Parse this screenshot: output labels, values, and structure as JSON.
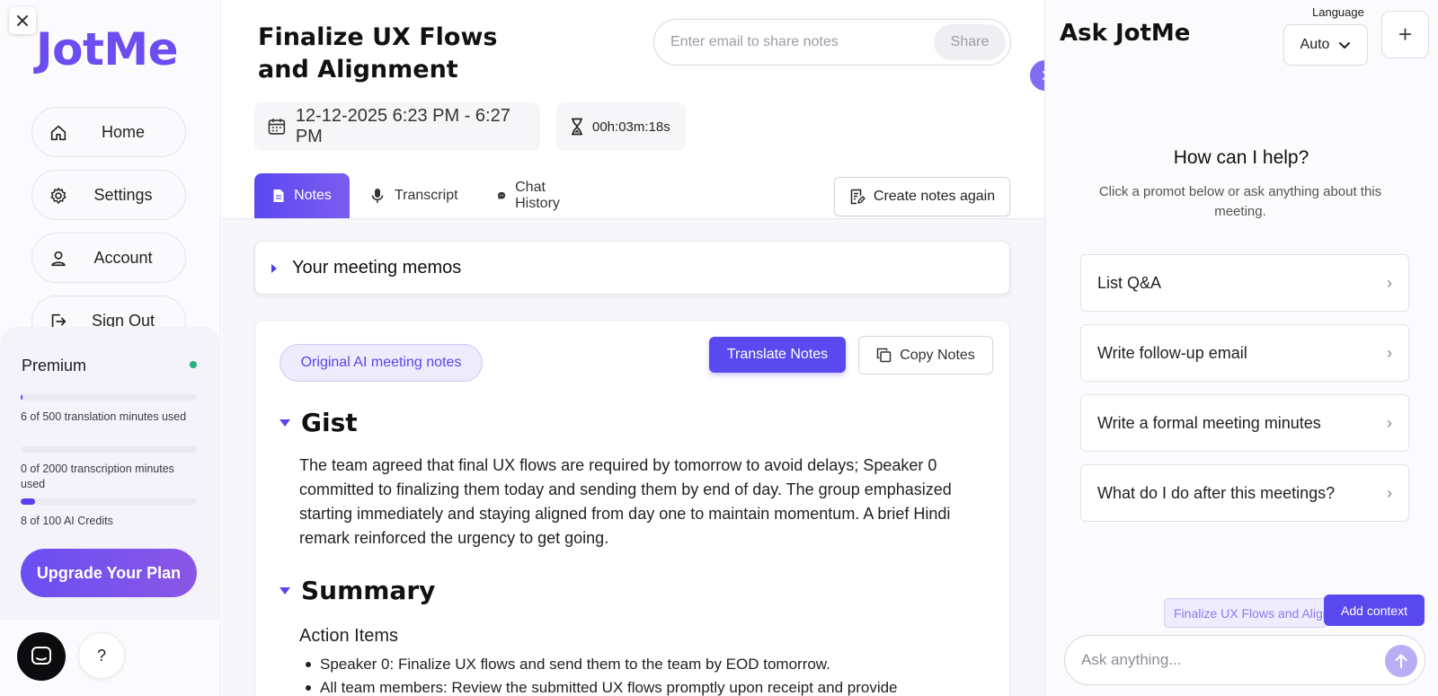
{
  "app": {
    "logo": "JotMe"
  },
  "sidebar": {
    "nav": [
      {
        "label": "Home",
        "icon": "home-icon"
      },
      {
        "label": "Settings",
        "icon": "gear-icon"
      },
      {
        "label": "Account",
        "icon": "user-icon"
      },
      {
        "label": "Sign Out",
        "icon": "sign-out-icon"
      }
    ],
    "plan": {
      "name": "Premium",
      "status_color": "#22b37a",
      "usage": [
        {
          "text": "6 of 500 translation minutes used",
          "used": 6,
          "total": 500
        },
        {
          "text": "0 of 2000 transcription minutes used",
          "used": 0,
          "total": 2000
        },
        {
          "text": "8 of 100 AI Credits",
          "used": 8,
          "total": 100
        }
      ],
      "upgrade_label": "Upgrade Your Plan"
    },
    "help_label": "?"
  },
  "meeting": {
    "title": "Finalize UX Flows and Alignment",
    "date_range": "12-12-2025 6:23 PM - 6:27 PM",
    "duration": "00h:03m:18s",
    "share": {
      "placeholder": "Enter email to share notes",
      "button_label": "Share"
    }
  },
  "tabs": [
    {
      "label": "Notes",
      "icon": "document-icon",
      "active": true
    },
    {
      "label": "Transcript",
      "icon": "microphone-icon",
      "active": false
    },
    {
      "label": "Chat History",
      "icon": "chat-bubble-icon",
      "active": false
    }
  ],
  "create_notes_label": "Create notes again",
  "memos_label": "Your meeting memos",
  "notes": {
    "badge": "Original AI meeting notes",
    "translate_label": "Translate Notes",
    "copy_label": "Copy Notes",
    "gist": {
      "heading": "Gist",
      "text": "The team agreed that final UX flows are required by tomorrow to avoid delays; Speaker 0 committed to finalizing them today and sending them by end of day. The group emphasized starting immediately and staying aligned from day one to maintain momentum. A brief Hindi remark reinforced the urgency to get going."
    },
    "summary": {
      "heading": "Summary",
      "action_items_title": "Action Items",
      "items": [
        "Speaker 0: Finalize UX flows and send them to the team by EOD tomorrow.",
        "All team members: Review the submitted UX flows promptly upon receipt and provide"
      ]
    }
  },
  "assistant": {
    "title": "Ask JotMe",
    "language_label": "Language",
    "language_value": "Auto",
    "plus_label": "+",
    "help_title": "How can I help?",
    "help_subtitle": "Click a promot below or ask anything about this meeting.",
    "prompts": [
      "List Q&A",
      "Write follow-up email",
      "Write a formal meeting minutes",
      "What do I do after this meetings?"
    ],
    "context_chip": "Finalize UX Flows and Alignment",
    "add_context_label": "Add context",
    "ask_placeholder": "Ask anything..."
  },
  "colors": {
    "accent": "#5b49f0",
    "logo": "#6b4df0"
  }
}
